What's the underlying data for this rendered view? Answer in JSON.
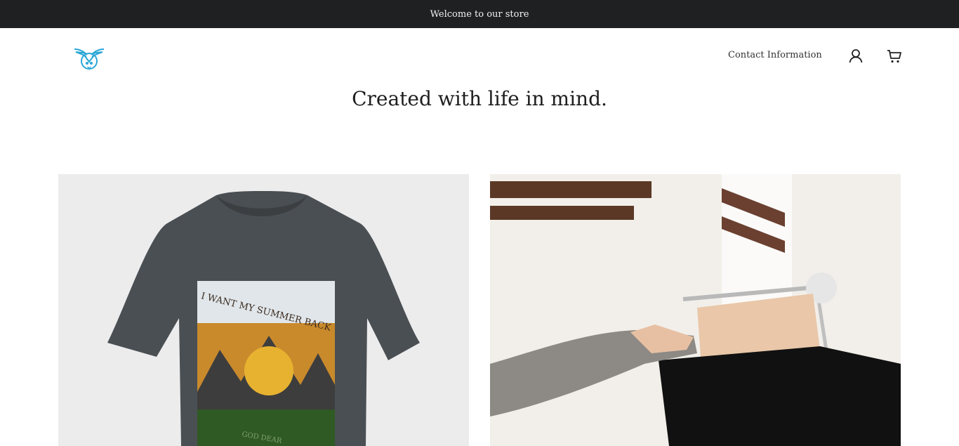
{
  "announcement": {
    "text": "Welcome to our store"
  },
  "header": {
    "logo": "owl-bird-logo",
    "nav": {
      "contact_label": "Contact Information"
    },
    "icons": {
      "account": "user-icon",
      "cart": "cart-icon"
    }
  },
  "hero": {
    "title": "Created with life in mind."
  },
  "collections": [
    {
      "image": "graphic-tshirt-photo",
      "print_top_text": "I WANT MY SUMMER BACK",
      "print_bottom_text": "GOD DEAR"
    },
    {
      "image": "clothing-rack-photo"
    }
  ],
  "colors": {
    "announcement_bg": "#1f2021",
    "logo_accent": "#2aa7d6",
    "text": "#222222"
  }
}
